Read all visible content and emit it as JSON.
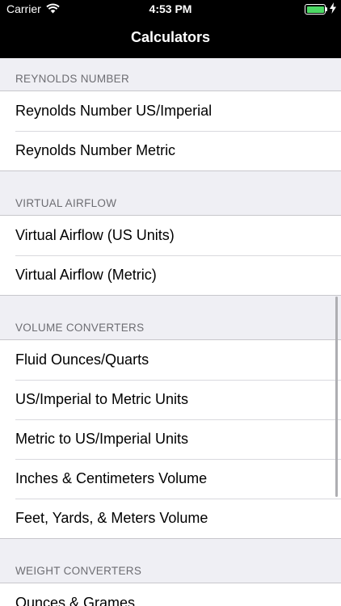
{
  "status_bar": {
    "carrier": "Carrier",
    "time": "4:53 PM",
    "battery_color": "#4cd964"
  },
  "nav": {
    "title": "Calculators"
  },
  "sections": [
    {
      "header": "REYNOLDS NUMBER",
      "items": [
        "Reynolds Number US/Imperial",
        "Reynolds Number Metric"
      ]
    },
    {
      "header": "VIRTUAL AIRFLOW",
      "items": [
        "Virtual Airflow (US Units)",
        "Virtual Airflow (Metric)"
      ]
    },
    {
      "header": "VOLUME CONVERTERS",
      "items": [
        "Fluid Ounces/Quarts",
        "US/Imperial to Metric Units",
        "Metric to US/Imperial Units",
        "Inches & Centimeters Volume",
        "Feet, Yards, & Meters Volume"
      ]
    },
    {
      "header": "WEIGHT CONVERTERS",
      "items": [
        "Ounces & Grames"
      ]
    }
  ]
}
